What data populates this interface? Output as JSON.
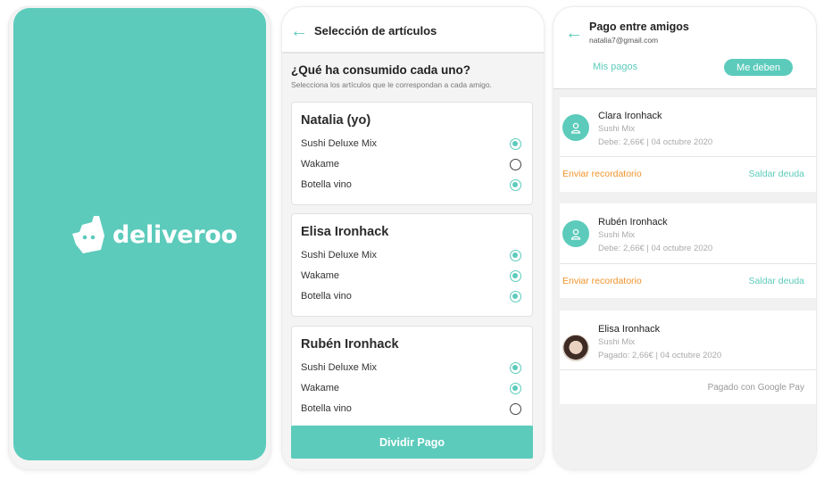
{
  "theme": {
    "brand": "#5ccbbb",
    "accent_orange": "#f0932b"
  },
  "splash": {
    "brand_name": "deliveroo",
    "logo_icon": "kangaroo-logo-icon"
  },
  "selection": {
    "header_title": "Selección de artículos",
    "question": "¿Qué ha consumido cada uno?",
    "subtitle": "Selecciona los artículos que le correspondan a cada amigo.",
    "friends": [
      {
        "name": "Natalia (yo)",
        "items": [
          {
            "label": "Sushi Deluxe Mix",
            "selected": true
          },
          {
            "label": "Wakame",
            "selected": false
          },
          {
            "label": "Botella vino",
            "selected": true
          }
        ]
      },
      {
        "name": "Elisa Ironhack",
        "items": [
          {
            "label": "Sushi Deluxe Mix",
            "selected": true
          },
          {
            "label": "Wakame",
            "selected": true
          },
          {
            "label": "Botella vino",
            "selected": true
          }
        ]
      },
      {
        "name": "Rubén Ironhack",
        "items": [
          {
            "label": "Sushi Deluxe Mix",
            "selected": true
          },
          {
            "label": "Wakame",
            "selected": true
          },
          {
            "label": "Botella vino",
            "selected": false
          }
        ]
      }
    ],
    "button_label": "Dividir Pago"
  },
  "payments": {
    "header_title": "Pago entre amigos",
    "email": "natalia7@gmail.com",
    "tabs": [
      "Mis pagos",
      "Me deben"
    ],
    "active_tab": "Me deben",
    "entries": [
      {
        "name": "Clara Ironhack",
        "order": "Sushi Mix",
        "status": "Debe: 2,66€ | 04 octubre 2020",
        "remind_label": "Enviar recordatorio",
        "settle_label": "Saldar deuda"
      },
      {
        "name": "Rubén Ironhack",
        "order": "Sushi Mix",
        "status": "Debe: 2,66€ | 04 octubre 2020",
        "remind_label": "Enviar recordatorio",
        "settle_label": "Saldar deuda"
      },
      {
        "name": "Elisa Ironhack",
        "order": "Sushi Mix",
        "status": "Pagado: 2,66€ | 04 octubre 2020",
        "paid_note": "Pagado con Google Pay"
      }
    ]
  }
}
